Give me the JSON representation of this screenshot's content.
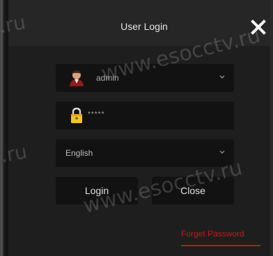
{
  "title_bar": {
    "title": "User Login",
    "close_icon": "close-icon"
  },
  "username": {
    "icon": "user-avatar-icon",
    "value": "admin",
    "dropdown_icon": "chevron-down-icon"
  },
  "password": {
    "icon": "lock-icon",
    "value": "*****"
  },
  "language": {
    "selected": "English",
    "dropdown_icon": "chevron-down-icon"
  },
  "buttons": {
    "login": "Login",
    "close": "Close"
  },
  "forgot_password": "Forget Password",
  "watermark": {
    "text": "www.esocctv.ru",
    "fragment": ".ru"
  },
  "colors": {
    "accent_red": "#c21a1a",
    "dialog_bg": "#1e1e1e",
    "title_bar_bg": "#262626",
    "field_bg": "#121212"
  }
}
